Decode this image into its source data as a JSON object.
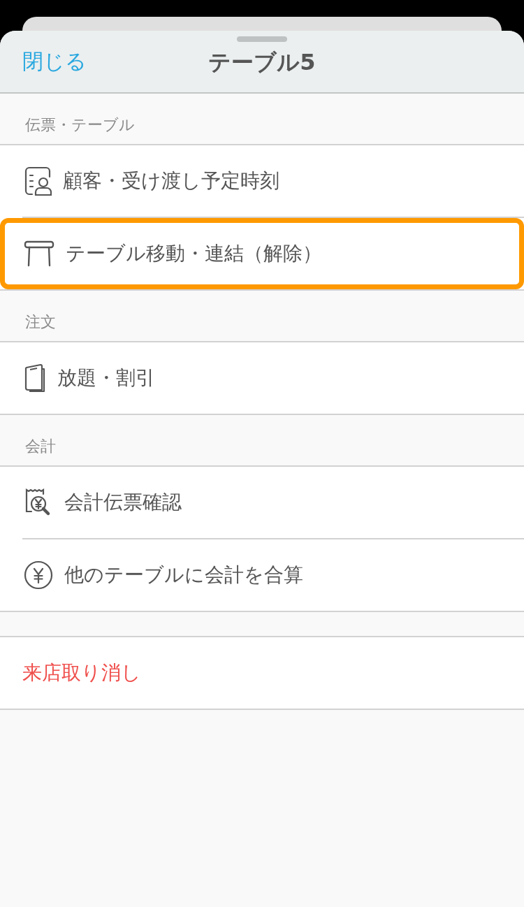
{
  "header": {
    "close": "閉じる",
    "title": "テーブル5"
  },
  "sections": [
    {
      "title": "伝票・テーブル",
      "items": [
        {
          "label": "顧客・受け渡し予定時刻",
          "kind": "customer",
          "highlighted": false
        },
        {
          "label": "テーブル移動・連結（解除）",
          "kind": "table",
          "highlighted": true
        }
      ]
    },
    {
      "title": "注文",
      "items": [
        {
          "label": "放題・割引",
          "kind": "booklet",
          "highlighted": false
        }
      ]
    },
    {
      "title": "会計",
      "items": [
        {
          "label": "会計伝票確認",
          "kind": "receipt",
          "highlighted": false
        },
        {
          "label": "他のテーブルに会計を合算",
          "kind": "yen",
          "highlighted": false
        }
      ]
    },
    {
      "items": [
        {
          "label": "来店取り消し",
          "kind": "danger",
          "highlighted": false
        }
      ]
    }
  ]
}
